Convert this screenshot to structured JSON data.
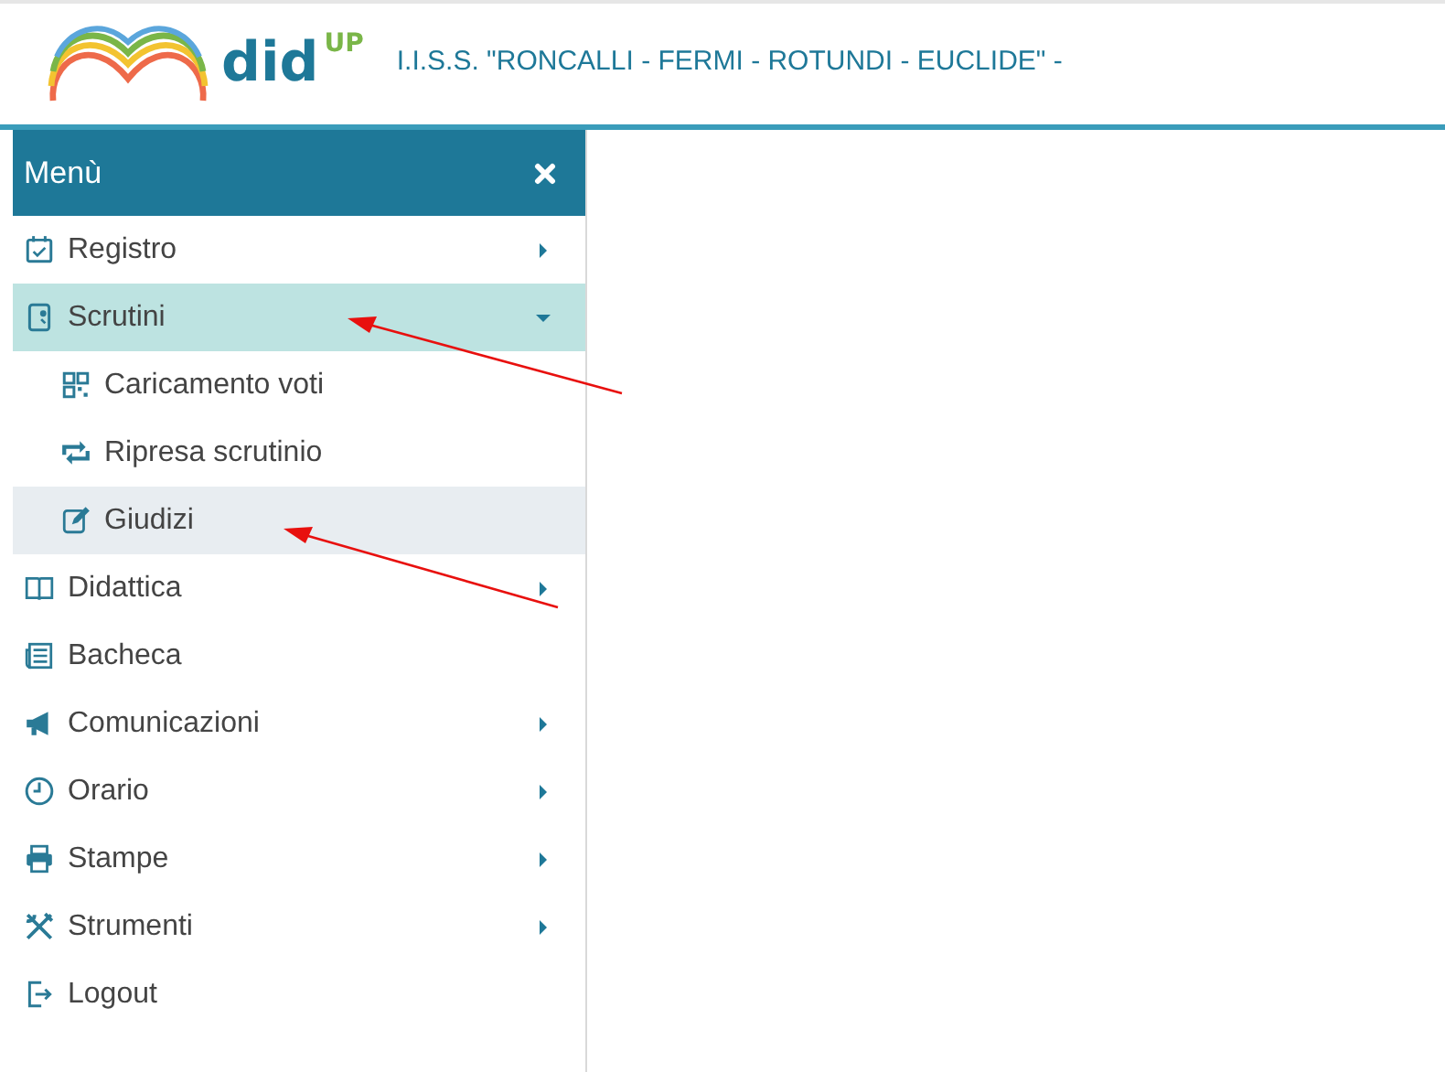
{
  "header": {
    "app_name": "did",
    "app_superscript": "UP",
    "school": "I.I.S.S. \"RONCALLI - FERMI - ROTUNDI - EUCLIDE\" -"
  },
  "sidebar": {
    "title": "Menù",
    "items": [
      {
        "label": "Registro",
        "has_submenu": true,
        "expanded": false,
        "selected": false
      },
      {
        "label": "Scrutini",
        "has_submenu": true,
        "expanded": true,
        "selected": true,
        "children": [
          {
            "label": "Caricamento voti",
            "selected": false
          },
          {
            "label": "Ripresa scrutinio",
            "selected": false
          },
          {
            "label": "Giudizi",
            "selected": true
          }
        ]
      },
      {
        "label": "Didattica",
        "has_submenu": true,
        "expanded": false,
        "selected": false
      },
      {
        "label": "Bacheca",
        "has_submenu": false,
        "selected": false
      },
      {
        "label": "Comunicazioni",
        "has_submenu": true,
        "expanded": false,
        "selected": false
      },
      {
        "label": "Orario",
        "has_submenu": true,
        "expanded": false,
        "selected": false
      },
      {
        "label": "Stampe",
        "has_submenu": true,
        "expanded": false,
        "selected": false
      },
      {
        "label": "Strumenti",
        "has_submenu": true,
        "expanded": false,
        "selected": false
      },
      {
        "label": "Logout",
        "has_submenu": false,
        "selected": false
      }
    ]
  }
}
